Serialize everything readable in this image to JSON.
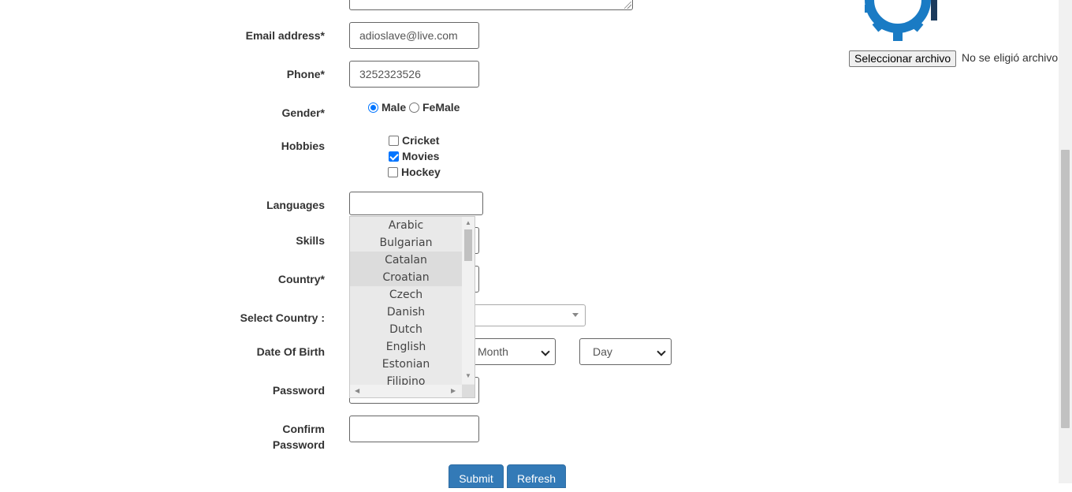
{
  "form": {
    "email": {
      "label": "Email address*",
      "value": "adioslave@live.com"
    },
    "phone": {
      "label": "Phone*",
      "value": "3252323526"
    },
    "gender": {
      "label": "Gender*",
      "options": [
        "Male",
        "FeMale"
      ],
      "selected": "Male"
    },
    "hobbies": {
      "label": "Hobbies",
      "options": [
        {
          "label": "Cricket",
          "checked": false
        },
        {
          "label": "Movies",
          "checked": true
        },
        {
          "label": "Hockey",
          "checked": false
        }
      ]
    },
    "languages": {
      "label": "Languages",
      "value": "",
      "dropdown": [
        "Arabic",
        "Bulgarian",
        "Catalan",
        "Croatian",
        "Czech",
        "Danish",
        "Dutch",
        "English",
        "Estonian",
        "Filipino"
      ],
      "highlighted": [
        "Catalan",
        "Croatian"
      ]
    },
    "skills": {
      "label": "Skills"
    },
    "country": {
      "label": "Country*"
    },
    "select_country": {
      "label": "Select Country :"
    },
    "dob": {
      "label": "Date Of Birth",
      "month": "Month",
      "day": "Day"
    },
    "password": {
      "label": "Password"
    },
    "confirm_password": {
      "label_line1": "Confirm",
      "label_line2": "Password"
    },
    "buttons": {
      "submit": "Submit",
      "refresh": "Refresh"
    }
  },
  "file_input": {
    "button": "Seleccionar archivo",
    "status": "No se eligió archivo"
  },
  "colors": {
    "primary": "#337ab7",
    "logo": "#1a7bc4",
    "check": "#0075ff"
  }
}
